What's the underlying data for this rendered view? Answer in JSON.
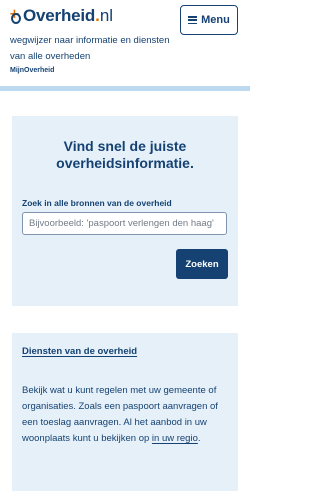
{
  "header": {
    "logo_name": "Overheid",
    "logo_dot": ".",
    "logo_tld": "nl",
    "menu_label": "Menu",
    "tagline": "wegwijzer naar informatie en diensten van alle overheden",
    "mijn_link": "MijnOverheid"
  },
  "search": {
    "title": "Vind snel de juiste overheidsinformatie.",
    "label": "Zoek in alle bronnen van de overheid",
    "placeholder": "Bijvoorbeeld: 'paspoort verlengen den haag'",
    "button": "Zoeken"
  },
  "services": {
    "title": "Diensten van de overheid",
    "body_text": "Bekijk wat u kunt regelen met uw gemeente of organisaties. Zoals een paspoort aanvragen of een toeslag aanvragen. Al het aanbod in uw woonplaats kunt u bekijken op ",
    "link_text": "in uw regio",
    "body_end": "."
  },
  "colors": {
    "brand": "#154273",
    "accent": "#e17000",
    "panel": "#e5f0f9",
    "header_bar": "#bcd9ef"
  }
}
